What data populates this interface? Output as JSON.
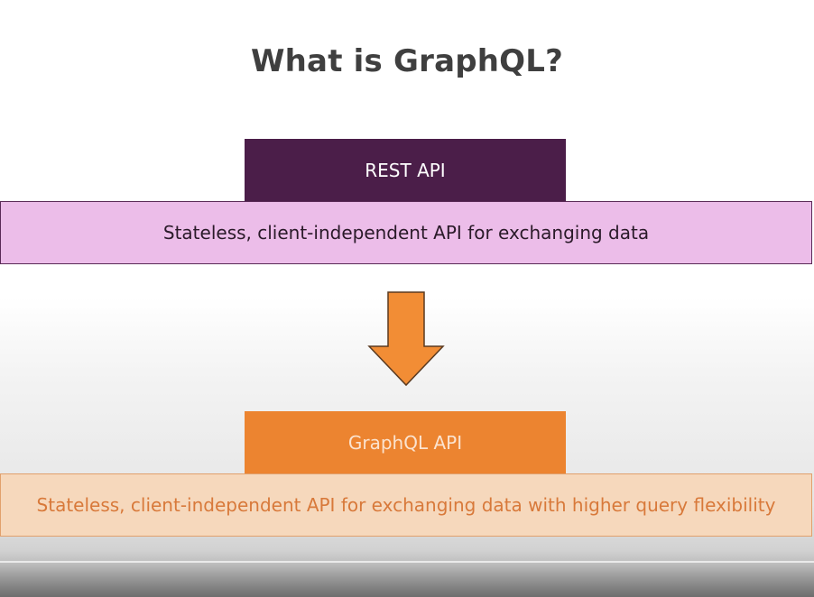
{
  "title": "What is GraphQL?",
  "rest": {
    "label": "REST API",
    "description": "Stateless, client-independent API for exchanging data"
  },
  "graphql": {
    "label": "GraphQL API",
    "description": "Stateless, client-independent API for exchanging data with higher query flexibility"
  },
  "colors": {
    "rest_tab": "#4b1e49",
    "rest_band": "#ecbde9",
    "graphql_tab": "#ec8430",
    "graphql_band": "#f6d8bc",
    "arrow": "#f28d35"
  },
  "icons": {
    "transition_arrow": "down-arrow-icon"
  }
}
